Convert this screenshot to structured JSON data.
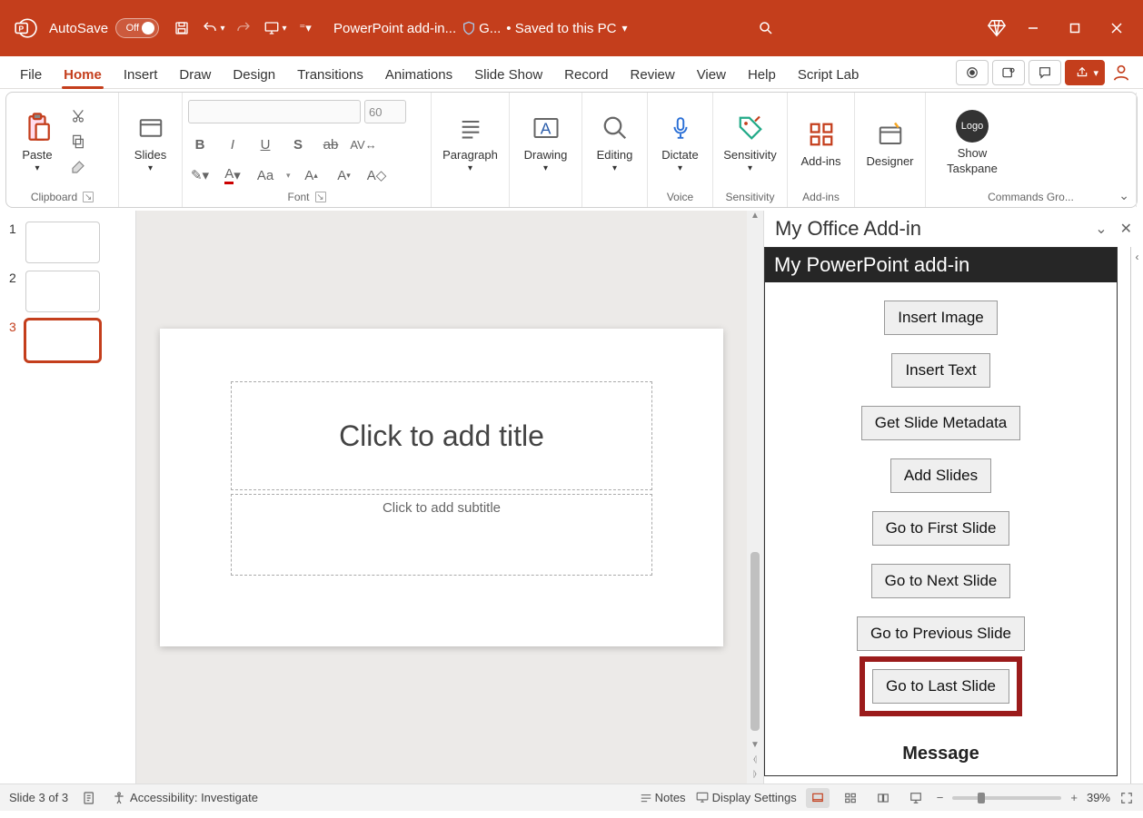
{
  "titlebar": {
    "autosave_label": "AutoSave",
    "autosave_state": "Off",
    "doc_name": "PowerPoint add-in...",
    "shield_text": "G...",
    "saved_text": "• Saved to this PC"
  },
  "tabs": [
    "File",
    "Home",
    "Insert",
    "Draw",
    "Design",
    "Transitions",
    "Animations",
    "Slide Show",
    "Record",
    "Review",
    "View",
    "Help",
    "Script Lab"
  ],
  "active_tab": "Home",
  "ribbon": {
    "clipboard": {
      "paste": "Paste",
      "label": "Clipboard"
    },
    "slides": {
      "btn": "Slides",
      "label": ""
    },
    "font": {
      "size": "60",
      "label": "Font",
      "aa": "Aa"
    },
    "paragraph": {
      "btn": "Paragraph"
    },
    "drawing": {
      "btn": "Drawing"
    },
    "editing": {
      "btn": "Editing"
    },
    "dictate": {
      "btn": "Dictate",
      "label": "Voice"
    },
    "sensitivity": {
      "btn": "Sensitivity",
      "label": "Sensitivity"
    },
    "addins": {
      "btn": "Add-ins",
      "label": "Add-ins"
    },
    "designer": {
      "btn": "Designer"
    },
    "showtp": {
      "btn1": "Show",
      "btn2": "Taskpane",
      "label": "Commands Gro...",
      "logo": "Logo"
    }
  },
  "thumbs": [
    1,
    2,
    3
  ],
  "selected_thumb": 3,
  "canvas": {
    "title_ph": "Click to add title",
    "sub_ph": "Click to add subtitle"
  },
  "taskpane": {
    "title": "My Office Add-in",
    "banner": "My PowerPoint add-in",
    "buttons": [
      "Insert Image",
      "Insert Text",
      "Get Slide Metadata",
      "Add Slides",
      "Go to First Slide",
      "Go to Next Slide",
      "Go to Previous Slide",
      "Go to Last Slide"
    ],
    "highlight_idx": 7,
    "message": "Message"
  },
  "status": {
    "slide": "Slide 3 of 3",
    "accessibility": "Accessibility: Investigate",
    "notes": "Notes",
    "display": "Display Settings",
    "zoom": "39%"
  }
}
